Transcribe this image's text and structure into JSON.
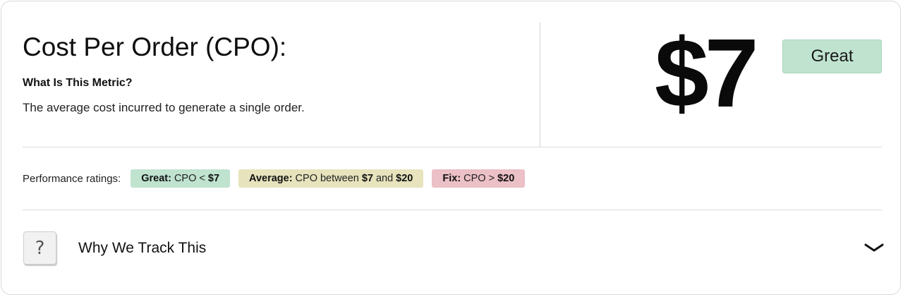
{
  "metric": {
    "title": "Cost Per Order (CPO):",
    "question": "What Is This Metric?",
    "description": "The average cost incurred to generate a single order.",
    "value": "$7",
    "status": "Great"
  },
  "ratings": {
    "label": "Performance ratings:",
    "great": {
      "name": "Great:",
      "pre": "CPO <",
      "threshold": "$7"
    },
    "average": {
      "name": "Average:",
      "pre": "CPO between",
      "low": "$7",
      "mid": "and",
      "high": "$20"
    },
    "fix": {
      "name": "Fix:",
      "pre": "CPO >",
      "threshold": "$20"
    }
  },
  "why": {
    "icon": "question-mark-icon",
    "icon_glyph": "?",
    "label": "Why We Track This",
    "toggle_icon": "chevron-down-icon"
  },
  "colors": {
    "great": "#bfe3cf",
    "average": "#e6e3bd",
    "fix": "#ebc0c6"
  }
}
